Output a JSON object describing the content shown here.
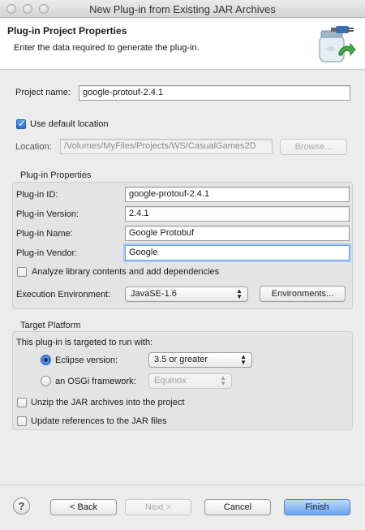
{
  "window": {
    "title": "New Plug-in from Existing JAR Archives"
  },
  "header": {
    "title": "Plug-in Project Properties",
    "description": "Enter the data required to generate the plug-in.",
    "icon": "plugin-jar-wizard-icon"
  },
  "project": {
    "name_label": "Project name:",
    "name_value": "google-protouf-2.4.1",
    "use_default_label": "Use default location",
    "use_default_checked": true,
    "location_label": "Location:",
    "location_value": "/Volumes/MyFiles/Projects/WS/CasualGames2D",
    "browse_label": "Browse..."
  },
  "plugin_props": {
    "title": "Plug-in Properties",
    "id_label": "Plug-in ID:",
    "id_value": "google-protouf-2.4.1",
    "version_label": "Plug-in Version:",
    "version_value": "2.4.1",
    "name_label": "Plug-in Name:",
    "name_value": "Google Protobuf",
    "vendor_label": "Plug-in Vendor:",
    "vendor_value": "Google",
    "analyze_label": "Analyze library contents and add dependencies",
    "analyze_checked": false,
    "exec_env_label": "Execution Environment:",
    "exec_env_value": "JavaSE-1.6",
    "environments_label": "Environments..."
  },
  "target": {
    "title": "Target Platform",
    "intro": "This plug-in is targeted to run with:",
    "eclipse_label": "Eclipse version:",
    "eclipse_value": "3.5 or greater",
    "eclipse_selected": true,
    "osgi_label": "an OSGi framework:",
    "osgi_value": "Equinox",
    "unzip_label": "Unzip the JAR archives into the project",
    "unzip_checked": false,
    "update_refs_label": "Update references to the JAR files",
    "update_refs_checked": false
  },
  "footer": {
    "help_label": "?",
    "back_label": "< Back",
    "next_label": "Next >",
    "cancel_label": "Cancel",
    "finish_label": "Finish"
  },
  "colors": {
    "accent": "#4c8ff0",
    "focus_ring": "#a9c8f2",
    "header_bg": "#ffffff",
    "dialog_bg": "#ececec"
  }
}
